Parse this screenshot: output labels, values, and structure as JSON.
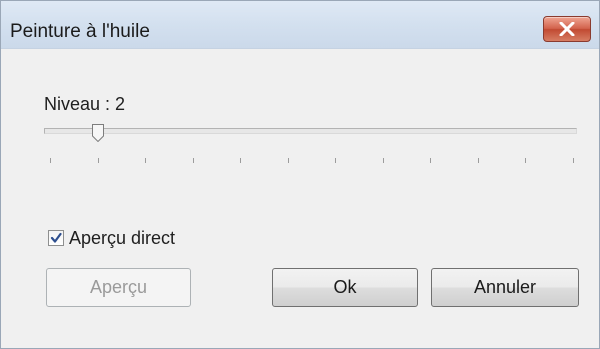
{
  "window": {
    "title": "Peinture à l'huile"
  },
  "slider": {
    "label": "Niveau : 2",
    "value": 2,
    "min": 1,
    "max": 12,
    "tick_count": 12
  },
  "checkbox": {
    "label": "Aperçu direct",
    "checked": true
  },
  "buttons": {
    "preview": "Aperçu",
    "ok": "Ok",
    "cancel": "Annuler"
  },
  "colors": {
    "close_button": "#c9553d",
    "window_background": "#f0f0f0"
  }
}
